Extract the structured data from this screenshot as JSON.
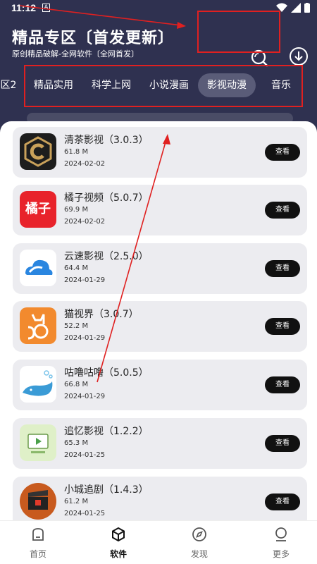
{
  "status_bar": {
    "time": "11:12",
    "a_label": "A"
  },
  "header": {
    "title": "精品专区〔首发更新〕",
    "subtitle": "原创精品破解-全网软件〔全网首发〕",
    "search_icon": "search-icon",
    "download_icon": "download-icon"
  },
  "tabs": [
    {
      "label": "区2"
    },
    {
      "label": "精品实用"
    },
    {
      "label": "科学上网"
    },
    {
      "label": "小说漫画"
    },
    {
      "label": "影视动漫",
      "active": true
    },
    {
      "label": "音乐"
    }
  ],
  "apps": [
    {
      "name": "清茶影视（3.0.3）",
      "size": "61.8 M",
      "date": "2024-02-02",
      "button": "查看",
      "icon_color": "#1d1d1d",
      "icon_glyph": "C"
    },
    {
      "name": "橘子视频（5.0.7）",
      "size": "69.9 M",
      "date": "2024-02-02",
      "button": "查看",
      "icon_color": "#e8232b",
      "icon_glyph": "橘子"
    },
    {
      "name": "云速影视（2.5.0）",
      "size": "64.4 M",
      "date": "2024-01-29",
      "button": "查看",
      "icon_color": "#ffffff",
      "icon_glyph": ""
    },
    {
      "name": "猫视界（3.0.7）",
      "size": "52.2 M",
      "date": "2024-01-29",
      "button": "查看",
      "icon_color": "#f28a2e",
      "icon_glyph": ""
    },
    {
      "name": "咕噜咕噜（5.0.5）",
      "size": "66.8 M",
      "date": "2024-01-29",
      "button": "查看",
      "icon_color": "#ffffff",
      "icon_glyph": ""
    },
    {
      "name": "追忆影视（1.2.2）",
      "size": "65.3 M",
      "date": "2024-01-25",
      "button": "查看",
      "icon_color": "#dff0c8",
      "icon_glyph": ""
    },
    {
      "name": "小城追剧（1.4.3）",
      "size": "61.2 M",
      "date": "2024-01-25",
      "button": "查看",
      "icon_color": "#c85a1e",
      "icon_glyph": ""
    }
  ],
  "bottom_nav": [
    {
      "label": "首页",
      "icon": "home-icon"
    },
    {
      "label": "软件",
      "icon": "cube-icon",
      "active": true
    },
    {
      "label": "发现",
      "icon": "compass-icon"
    },
    {
      "label": "更多",
      "icon": "user-icon"
    }
  ],
  "colors": {
    "header_bg": "#2f3150",
    "active_tab": "#5a5c78",
    "button_bg": "#111111",
    "annotation": "#e02020"
  }
}
